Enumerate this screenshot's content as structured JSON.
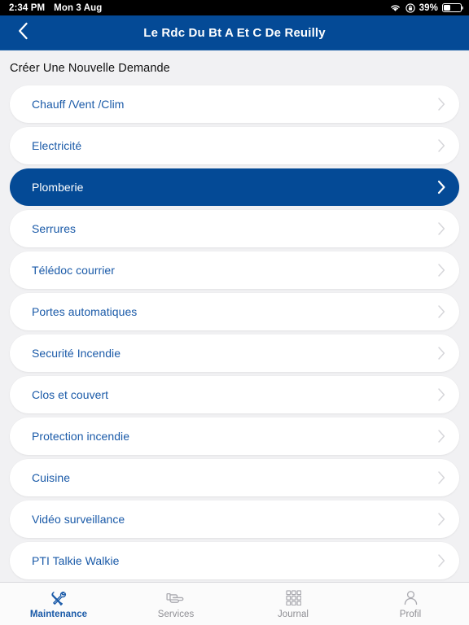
{
  "status_bar": {
    "time": "2:34 PM",
    "date": "Mon 3 Aug",
    "battery_percent": "39%",
    "battery_level": 39,
    "wifi_icon": "wifi-icon",
    "lock_icon": "rotation-lock-icon",
    "battery_icon": "battery-icon"
  },
  "navbar": {
    "title": "Le Rdc Du Bt A Et C De Reuilly",
    "back_icon": "chevron-left-icon",
    "background_color": "#044a96"
  },
  "main": {
    "page_title": "Créer Une Nouvelle Demande",
    "accent_color": "#1a5aa8",
    "selected_color": "#044a96",
    "items": [
      {
        "label": "Chauff /Vent /Clim",
        "selected": false
      },
      {
        "label": "Electricité",
        "selected": false
      },
      {
        "label": "Plomberie",
        "selected": true
      },
      {
        "label": "Serrures",
        "selected": false
      },
      {
        "label": "Télédoc courrier",
        "selected": false
      },
      {
        "label": "Portes automatiques",
        "selected": false
      },
      {
        "label": "Securité Incendie",
        "selected": false
      },
      {
        "label": "Clos et couvert",
        "selected": false
      },
      {
        "label": "Protection incendie",
        "selected": false
      },
      {
        "label": "Cuisine",
        "selected": false
      },
      {
        "label": "Vidéo surveillance",
        "selected": false
      },
      {
        "label": "PTI Talkie Walkie",
        "selected": false
      }
    ],
    "chevron_icon": "chevron-right-icon"
  },
  "tabbar": {
    "tabs": [
      {
        "label": "Maintenance",
        "icon": "tools-icon",
        "active": true
      },
      {
        "label": "Services",
        "icon": "hand-icon",
        "active": false
      },
      {
        "label": "Journal",
        "icon": "grid-icon",
        "active": false
      },
      {
        "label": "Profil",
        "icon": "person-icon",
        "active": false
      }
    ]
  }
}
